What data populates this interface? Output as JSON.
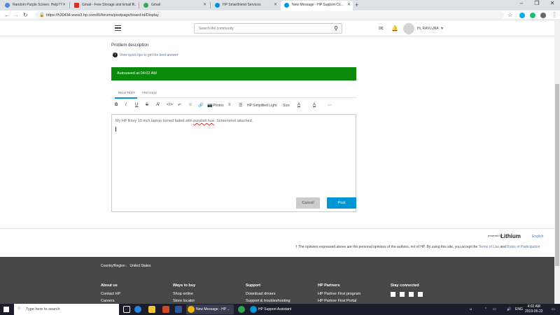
{
  "browser": {
    "tabs": [
      {
        "label": "Random Purple Screen: Help??",
        "color": "#4a8be0"
      },
      {
        "label": "Gmail - Free Storage and Email f...",
        "color": "#d93025"
      },
      {
        "label": "Gmail",
        "color": "#34a853"
      },
      {
        "label": "HP Smartfriend Services",
        "color": "#0096d6"
      },
      {
        "label": "New Message - HP Support Co...",
        "color": "#0096d6"
      }
    ],
    "url": "https://h30434.www3.hp.com/t5/forums/postpage/board-id/Display"
  },
  "header": {
    "search_placeholder": "Search the community",
    "greeting": "Hi, RAVLUNA"
  },
  "form": {
    "problem_label": "Problem description",
    "tips_prefix": "View ",
    "tips_link": "quick tips to get the best answer",
    "autosave": "Autosaved at 04:02 AM",
    "tab_rich": "RICH TEXT",
    "tab_preview": "PREVIEW",
    "toolbar": {
      "photos": "Photos",
      "font": "HP Simplified Light",
      "size": "Size"
    },
    "body_before": "My HP Envy 15 inch laptop turned faded with ",
    "body_highlight": "purplish hue",
    "body_after": ". Screenshot attached.",
    "error_count": "2",
    "cancel": "Cancel",
    "post": "Post"
  },
  "attribution": {
    "powered": "powered by",
    "brand": "Lithium",
    "language": "English",
    "disclaimer_pre": "† The opinions expressed above are the personal opinions of the authors, not of HP. By using this site, you accept the ",
    "terms": "Terms of Use",
    "and": " and ",
    "rules": "Rules of Participation"
  },
  "footer": {
    "country_label": "Country/Region :",
    "country_value": "United States",
    "columns": [
      {
        "title": "About us",
        "items": [
          "Contact HP",
          "Careers"
        ]
      },
      {
        "title": "Ways to buy",
        "items": [
          "Shop online",
          "Store locator"
        ]
      },
      {
        "title": "Support",
        "items": [
          "Download drivers",
          "Support & troubleshooting"
        ]
      },
      {
        "title": "HP Partners",
        "items": [
          "HP Partner First program",
          "HP Partner First Portal"
        ]
      },
      {
        "title": "Stay connected",
        "items": []
      }
    ]
  },
  "taskbar": {
    "search_placeholder": "Type here to search",
    "apps": [
      {
        "label": "New Message - HP ...",
        "color": "#f4b400"
      },
      {
        "label": "HP Support Assistant",
        "color": "#0096d6"
      }
    ],
    "lang": "ENG",
    "time": "4:02 AM",
    "date": "2019-05-22"
  }
}
